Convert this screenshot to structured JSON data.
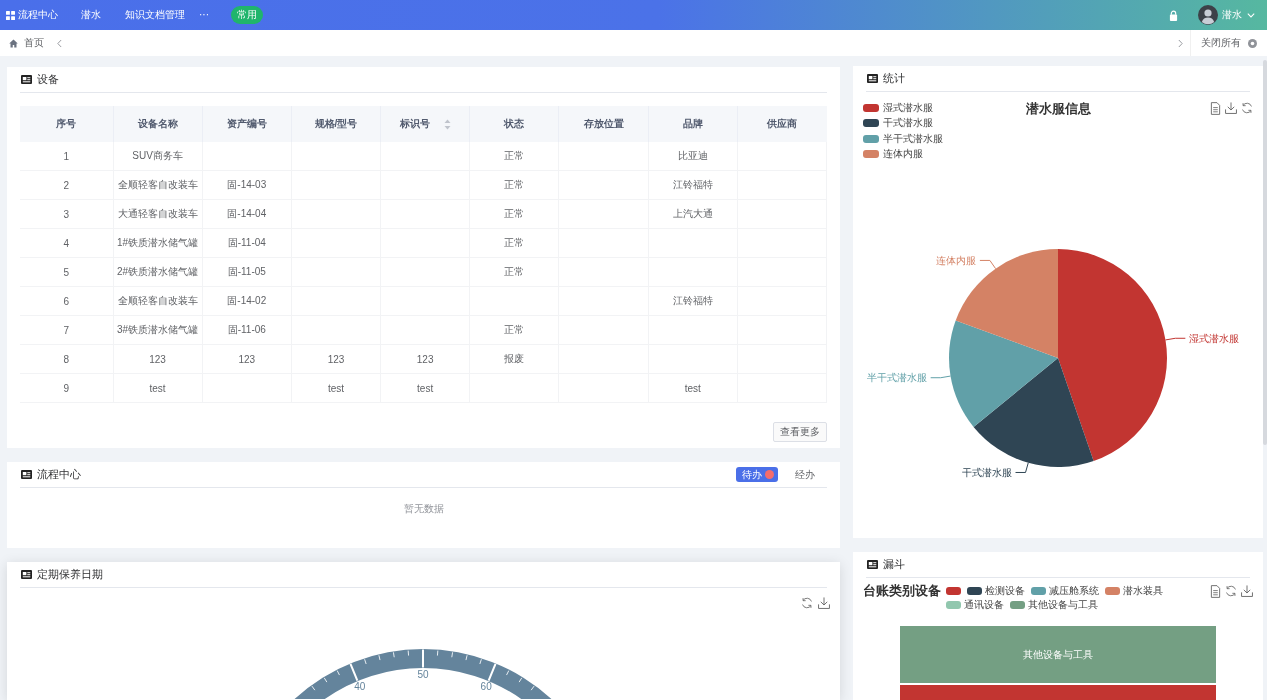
{
  "top_nav": {
    "apps_menu": "流程中心",
    "menu_items": [
      "潜水",
      "知识文档管理"
    ],
    "more": "···",
    "pill": "常用",
    "user": {
      "name": "潜水"
    }
  },
  "tabs_bar": {
    "tabs": [
      {
        "label": "首页"
      }
    ],
    "close_all": "关闭所有"
  },
  "equipment_card": {
    "title": "设备",
    "table": {
      "columns": [
        {
          "label": "序号",
          "sortable": false
        },
        {
          "label": "设备名称",
          "sortable": false
        },
        {
          "label": "资产编号",
          "sortable": false
        },
        {
          "label": "规格/型号",
          "sortable": false
        },
        {
          "label": "标识号",
          "sortable": true
        },
        {
          "label": "状态",
          "sortable": false
        },
        {
          "label": "存放位置",
          "sortable": false
        },
        {
          "label": "品牌",
          "sortable": false
        },
        {
          "label": "供应商",
          "sortable": false
        }
      ],
      "rows": [
        [
          "1",
          "SUV商务车",
          null,
          null,
          null,
          "正常",
          null,
          "比亚迪",
          null
        ],
        [
          "2",
          "全顺轻客自改装车",
          "固-14-03",
          null,
          null,
          "正常",
          null,
          "江铃福特",
          null
        ],
        [
          "3",
          "大通轻客自改装车",
          "固-14-04",
          null,
          null,
          "正常",
          null,
          "上汽大通",
          null
        ],
        [
          "4",
          "1#铁质潜水储气罐",
          "固-11-04",
          null,
          null,
          "正常",
          null,
          null,
          null
        ],
        [
          "5",
          "2#铁质潜水储气罐",
          "固-11-05",
          null,
          null,
          "正常",
          null,
          null,
          null
        ],
        [
          "6",
          "全顺轻客自改装车",
          "固-14-02",
          null,
          null,
          null,
          null,
          "江铃福特",
          null
        ],
        [
          "7",
          "3#铁质潜水储气罐",
          "固-11-06",
          null,
          null,
          "正常",
          null,
          null,
          null
        ],
        [
          "8",
          "123",
          "123",
          "123",
          "123",
          "报废",
          null,
          null,
          null
        ],
        [
          "9",
          "test",
          null,
          "test",
          "test",
          null,
          null,
          "test",
          null
        ]
      ]
    },
    "more_button": "查看更多"
  },
  "process_card": {
    "title": "流程中心",
    "tabs": [
      {
        "label": "待办",
        "selected": true,
        "badge": true
      },
      {
        "label": "经办",
        "selected": false,
        "badge": false
      }
    ],
    "empty_text": "暂无数据"
  },
  "maintenance_card": {
    "title": "定期保养日期",
    "gauge": {
      "axis_labels": [
        "40",
        "50",
        "60"
      ]
    }
  },
  "stats_card": {
    "title": "统计",
    "chart": {
      "title": "潜水服信息",
      "legend": [
        {
          "label": "湿式潜水服",
          "color": "#c23531"
        },
        {
          "label": "干式潜水服",
          "color": "#2f4554"
        },
        {
          "label": "半干式潜水服",
          "color": "#61a0a8"
        },
        {
          "label": "连体内服",
          "color": "#d48265"
        }
      ],
      "slices": [
        {
          "label": "湿式潜水服",
          "color": "#c23531"
        },
        {
          "label": "干式潜水服",
          "color": "#2f4554"
        },
        {
          "label": "半干式潜水服",
          "color": "#61a0a8"
        },
        {
          "label": "连体内服",
          "color": "#d48265"
        }
      ]
    }
  },
  "funnel_card": {
    "title": "漏斗",
    "chart": {
      "title": "台账类别设备",
      "legend": [
        {
          "color": "#c23531"
        },
        {
          "label": "检测设备",
          "color": "#2f4554"
        },
        {
          "label": "减压舱系统",
          "color": "#61a0a8"
        },
        {
          "label": "潜水装具",
          "color": "#d48265"
        },
        {
          "label": "通讯设备",
          "color": "#91c7ae"
        },
        {
          "label": "其他设备与工具",
          "color": "#749f83"
        }
      ],
      "layers": [
        {
          "label": "其他设备与工具",
          "color": "#749f83"
        },
        {
          "color": "#c23531"
        }
      ]
    }
  }
}
